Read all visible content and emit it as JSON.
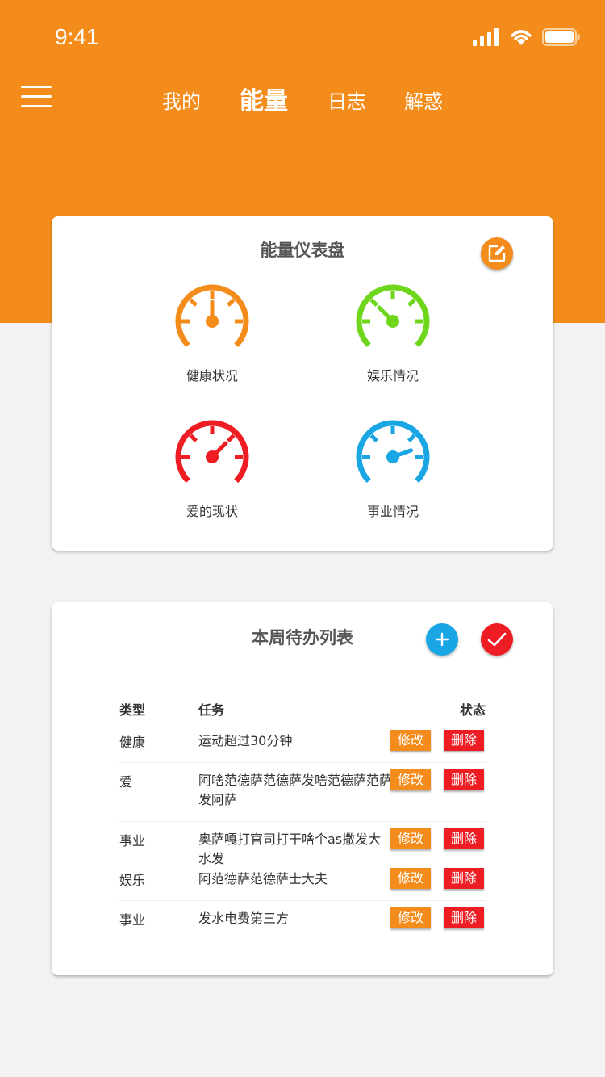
{
  "status_bar": {
    "time": "9:41"
  },
  "nav": {
    "tabs": [
      {
        "label": "我的",
        "active": false
      },
      {
        "label": "能量",
        "active": true
      },
      {
        "label": "日志",
        "active": false
      },
      {
        "label": "解惑",
        "active": false
      }
    ]
  },
  "dashboard": {
    "title": "能量仪表盘",
    "gauges": [
      {
        "label": "健康状况",
        "color": "#f48c1c"
      },
      {
        "label": "娱乐情况",
        "color": "#6ed61b"
      },
      {
        "label": "爱的现状",
        "color": "#ee1d24"
      },
      {
        "label": "事业情况",
        "color": "#1aa6e4"
      }
    ]
  },
  "todo": {
    "title": "本周待办列表",
    "headers": {
      "type": "类型",
      "task": "任务",
      "status": "状态"
    },
    "edit_label": "修改",
    "delete_label": "删除",
    "rows": [
      {
        "type": "健康",
        "task": "运动超过30分钟"
      },
      {
        "type": "爱",
        "task": "阿啥范德萨范德萨发啥范德萨范萨发阿萨"
      },
      {
        "type": "事业",
        "task": "奥萨嘎打官司打干啥个as撒发大水发"
      },
      {
        "type": "娱乐",
        "task": "阿范德萨范德萨士大夫"
      },
      {
        "type": "事业",
        "task": "发水电费第三方"
      }
    ]
  },
  "colors": {
    "accent": "#f48c1c",
    "add": "#1aa6e4",
    "confirm": "#ee1d24"
  }
}
